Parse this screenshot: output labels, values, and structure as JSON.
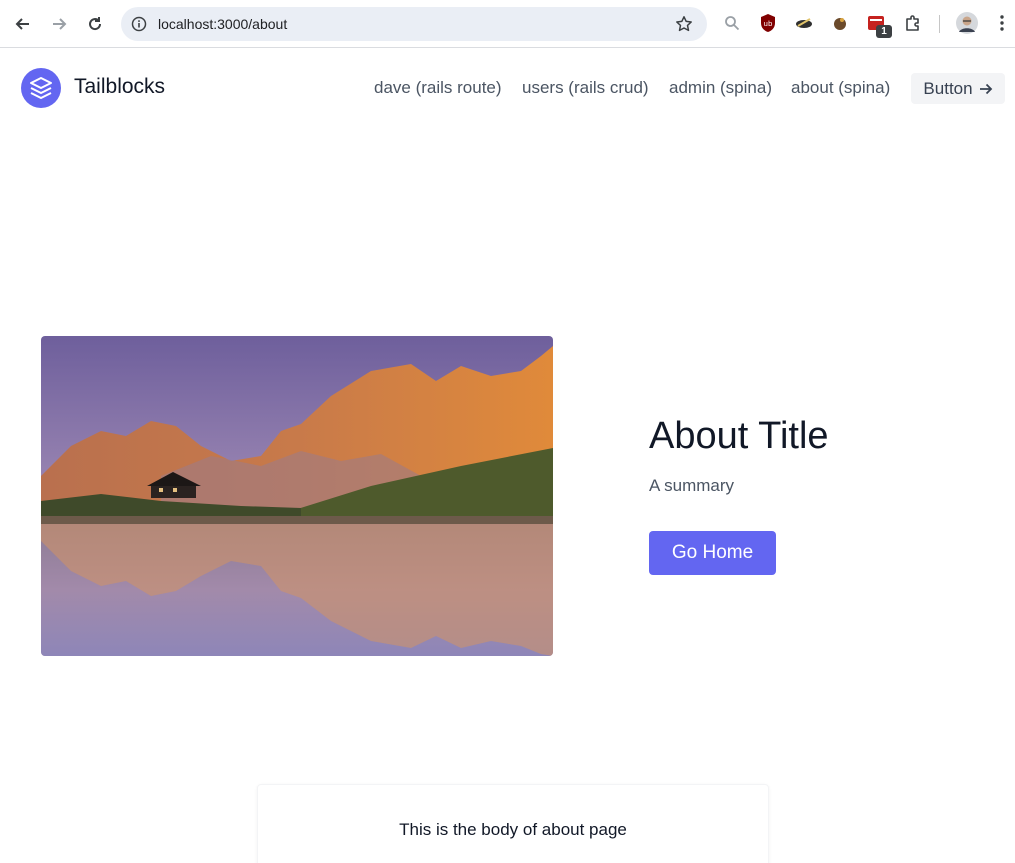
{
  "browser": {
    "url": "localhost:3000/about",
    "extension_badge": "1",
    "icons": [
      "back-icon",
      "forward-icon",
      "reload-icon",
      "info-icon",
      "star-icon",
      "search-icon",
      "ublock-icon",
      "extension-icon",
      "extension-icon",
      "extension-icon",
      "puzzle-icon",
      "profile-avatar",
      "kebab-menu-icon"
    ]
  },
  "header": {
    "brand": "Tailblocks",
    "nav": [
      {
        "label": "dave (rails route)"
      },
      {
        "label": "users (rails crud)"
      },
      {
        "label": "admin (spina)"
      },
      {
        "label": "about (spina)"
      }
    ],
    "button_label": "Button",
    "accent": "#6366f1"
  },
  "hero": {
    "title": "About Title",
    "summary": "A summary",
    "button_label": "Go Home",
    "image_alt": "mountain-lake"
  },
  "body": {
    "text": "This is the body of about page"
  }
}
